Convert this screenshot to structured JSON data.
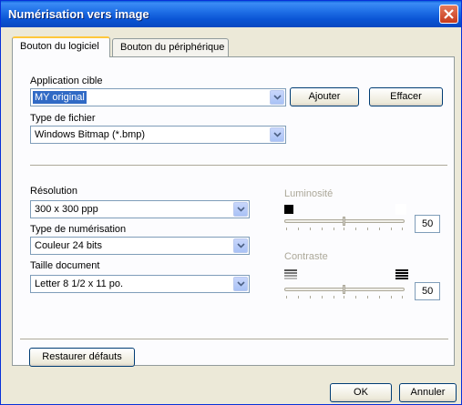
{
  "window": {
    "title": "Numérisation vers image"
  },
  "tabs": [
    {
      "label": "Bouton du logiciel"
    },
    {
      "label": "Bouton du périphérique"
    }
  ],
  "app_target": {
    "label": "Application cible",
    "value": "MY original",
    "add_label": "Ajouter",
    "delete_label": "Effacer"
  },
  "file_type": {
    "label": "Type de fichier",
    "value": "Windows Bitmap (*.bmp)"
  },
  "resolution": {
    "label": "Résolution",
    "value": "300 x 300 ppp"
  },
  "scan_type": {
    "label": "Type de numérisation",
    "value": "Couleur 24 bits"
  },
  "doc_size": {
    "label": "Taille document",
    "value": "Letter 8 1/2 x 11 po."
  },
  "brightness": {
    "label": "Luminosité",
    "value": "50"
  },
  "contrast": {
    "label": "Contraste",
    "value": "50"
  },
  "buttons": {
    "restore": "Restaurer défauts",
    "ok": "OK",
    "cancel": "Annuler"
  }
}
